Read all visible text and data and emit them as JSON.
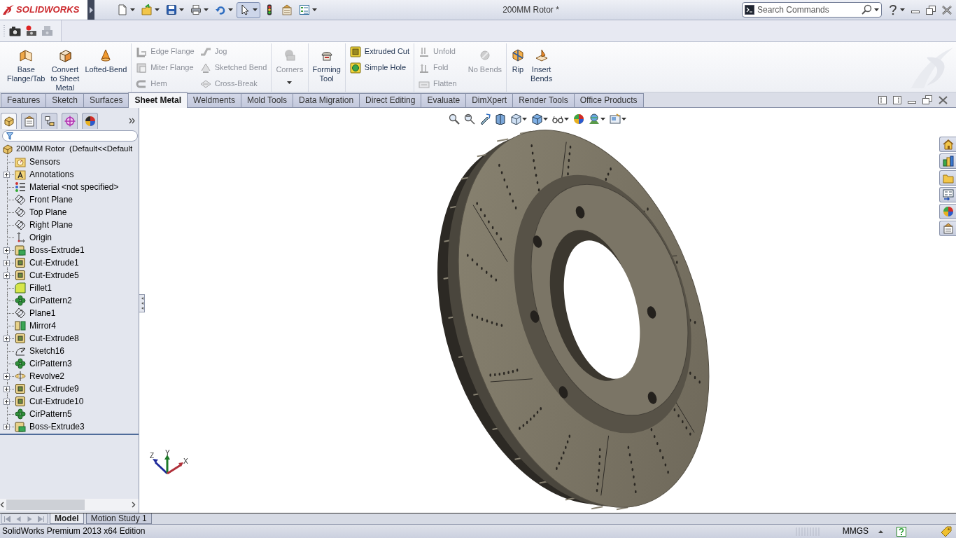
{
  "title_bar": {
    "logo": "SOLIDWORKS",
    "document_title": "200MM Rotor *",
    "search": {
      "placeholder": "Search Commands"
    },
    "quick_access": [
      {
        "kind": "new",
        "dropdown": true,
        "selected": false
      },
      {
        "kind": "open",
        "dropdown": true,
        "selected": false
      },
      {
        "kind": "save",
        "dropdown": true,
        "selected": false
      },
      {
        "kind": "print",
        "dropdown": true,
        "selected": false
      },
      {
        "kind": "undo",
        "dropdown": true,
        "selected": false
      },
      {
        "kind": "select",
        "dropdown": true,
        "selected": true
      },
      {
        "kind": "rebuild",
        "dropdown": false,
        "selected": false
      },
      {
        "kind": "file-properties",
        "dropdown": false,
        "selected": false
      },
      {
        "kind": "options",
        "dropdown": true,
        "selected": false
      }
    ]
  },
  "ribbon": {
    "groups": [
      {
        "items": [
          {
            "kind": "large",
            "label": "Base\nFlange/Tab",
            "disabled": false,
            "dropdown": false
          },
          {
            "kind": "large",
            "label": "Convert\nto Sheet\nMetal",
            "disabled": false,
            "dropdown": false
          },
          {
            "kind": "large",
            "label": "Lofted-Bend",
            "disabled": false,
            "dropdown": false
          }
        ]
      },
      {
        "items": [
          {
            "kind": "small",
            "label": "Edge Flange",
            "disabled": true
          },
          {
            "kind": "small",
            "label": "Miter Flange",
            "disabled": true
          },
          {
            "kind": "small",
            "label": "Hem",
            "disabled": true
          },
          {
            "kind": "small",
            "label": "Jog",
            "disabled": true
          },
          {
            "kind": "small",
            "label": "Sketched Bend",
            "disabled": true
          },
          {
            "kind": "small",
            "label": "Cross-Break",
            "disabled": true
          }
        ]
      },
      {
        "items": [
          {
            "kind": "large",
            "label": "Corners",
            "disabled": true,
            "dropdown": true
          }
        ]
      },
      {
        "items": [
          {
            "kind": "large",
            "label": "Forming\nTool",
            "disabled": false,
            "dropdown": false
          }
        ]
      },
      {
        "items": [
          {
            "kind": "small",
            "label": "Extruded Cut",
            "disabled": false
          },
          {
            "kind": "small",
            "label": "Simple Hole",
            "disabled": false
          }
        ]
      },
      {
        "items": [
          {
            "kind": "small",
            "label": "Unfold",
            "disabled": true
          },
          {
            "kind": "small",
            "label": "Fold",
            "disabled": true
          },
          {
            "kind": "small",
            "label": "Flatten",
            "disabled": true
          },
          {
            "kind": "large",
            "label": "No Bends",
            "disabled": true,
            "dropdown": false
          }
        ]
      },
      {
        "items": [
          {
            "kind": "large",
            "label": "Rip",
            "disabled": false,
            "dropdown": false
          },
          {
            "kind": "large",
            "label": "Insert\nBends",
            "disabled": false,
            "dropdown": false
          }
        ]
      }
    ]
  },
  "command_tabs": [
    {
      "label": "Features",
      "selected": false
    },
    {
      "label": "Sketch",
      "selected": false
    },
    {
      "label": "Surfaces",
      "selected": false
    },
    {
      "label": "Sheet Metal",
      "selected": true
    },
    {
      "label": "Weldments",
      "selected": false
    },
    {
      "label": "Mold Tools",
      "selected": false
    },
    {
      "label": "Data Migration",
      "selected": false
    },
    {
      "label": "Direct Editing",
      "selected": false
    },
    {
      "label": "Evaluate",
      "selected": false
    },
    {
      "label": "DimXpert",
      "selected": false
    },
    {
      "label": "Render Tools",
      "selected": false
    },
    {
      "label": "Office Products",
      "selected": false
    }
  ],
  "feature_manager": {
    "panel_tabs": [
      {
        "kind": "feature-tree",
        "selected": true
      },
      {
        "kind": "property-manager",
        "selected": false
      },
      {
        "kind": "configuration-manager",
        "selected": false
      },
      {
        "kind": "dimxpert-manager",
        "selected": false
      },
      {
        "kind": "display-manager",
        "selected": false
      }
    ],
    "tree": {
      "label": "200MM Rotor  (Default<<Default",
      "kind": "part",
      "children": [
        {
          "label": "Sensors",
          "kind": "sensors",
          "expandable": false
        },
        {
          "label": "Annotations",
          "kind": "annotations",
          "expandable": true
        },
        {
          "label": "Material <not specified>",
          "kind": "material",
          "expandable": false
        },
        {
          "label": "Front Plane",
          "kind": "plane",
          "expandable": false
        },
        {
          "label": "Top Plane",
          "kind": "plane",
          "expandable": false
        },
        {
          "label": "Right Plane",
          "kind": "plane",
          "expandable": false
        },
        {
          "label": "Origin",
          "kind": "origin",
          "expandable": false
        },
        {
          "label": "Boss-Extrude1",
          "kind": "boss-extrude",
          "expandable": true
        },
        {
          "label": "Cut-Extrude1",
          "kind": "cut-extrude",
          "expandable": true
        },
        {
          "label": "Cut-Extrude5",
          "kind": "cut-extrude",
          "expandable": true
        },
        {
          "label": "Fillet1",
          "kind": "fillet",
          "expandable": false
        },
        {
          "label": "CirPattern2",
          "kind": "circular-pattern",
          "expandable": false
        },
        {
          "label": "Plane1",
          "kind": "plane",
          "expandable": false
        },
        {
          "label": "Mirror4",
          "kind": "mirror",
          "expandable": false
        },
        {
          "label": "Cut-Extrude8",
          "kind": "cut-extrude",
          "expandable": true
        },
        {
          "label": "Sketch16",
          "kind": "sketch",
          "expandable": false
        },
        {
          "label": "CirPattern3",
          "kind": "circular-pattern",
          "expandable": false
        },
        {
          "label": "Revolve2",
          "kind": "revolve",
          "expandable": true
        },
        {
          "label": "Cut-Extrude9",
          "kind": "cut-extrude",
          "expandable": true
        },
        {
          "label": "Cut-Extrude10",
          "kind": "cut-extrude",
          "expandable": true
        },
        {
          "label": "CirPattern5",
          "kind": "circular-pattern",
          "expandable": false
        },
        {
          "label": "Boss-Extrude3",
          "kind": "boss-extrude",
          "expandable": true
        }
      ]
    }
  },
  "viewport": {
    "triad": [
      {
        "label": "Z"
      },
      {
        "label": "Y"
      },
      {
        "label": "X"
      }
    ]
  },
  "bottom_tabs": [
    {
      "label": "Model",
      "selected": true
    },
    {
      "label": "Motion Study 1",
      "selected": false
    }
  ],
  "status_bar": {
    "edition": "SolidWorks Premium 2013 x64 Edition",
    "units": "MMGS"
  }
}
